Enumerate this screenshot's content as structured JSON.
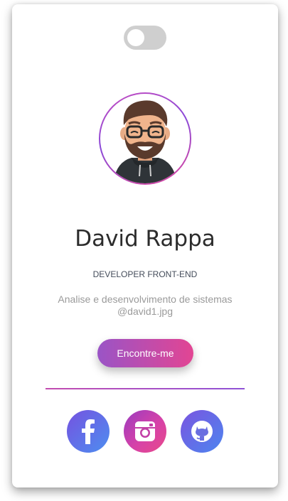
{
  "profile": {
    "name": "David Rappa",
    "role": "DEVELOPER FRONT-END",
    "description_line1": "Analise e desenvolvimento de sistemas",
    "description_line2": "@david1.jpg",
    "cta_label": "Encontre-me"
  },
  "theme_toggle": {
    "state": "off"
  },
  "social_links": [
    {
      "network": "facebook",
      "icon": "facebook-icon"
    },
    {
      "network": "instagram",
      "icon": "instagram-icon"
    },
    {
      "network": "github",
      "icon": "github-icon"
    }
  ],
  "colors": {
    "gradient_start": "#9a54c6",
    "gradient_end": "#e24593",
    "name_text": "#2c2c2c",
    "muted_text": "#9a9a9a"
  }
}
